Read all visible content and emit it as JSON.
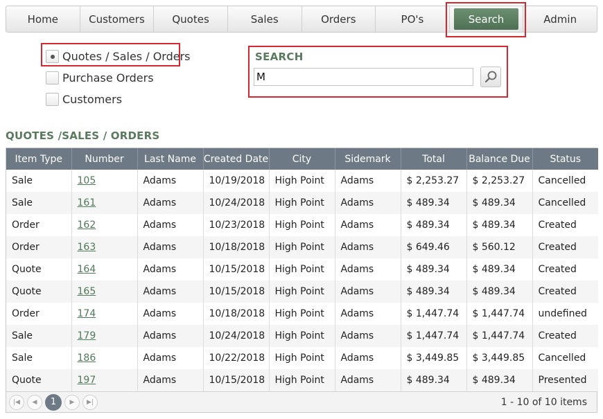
{
  "nav": {
    "items": [
      {
        "label": "Home"
      },
      {
        "label": "Customers"
      },
      {
        "label": "Quotes"
      },
      {
        "label": "Sales"
      },
      {
        "label": "Orders"
      },
      {
        "label": "PO's"
      },
      {
        "label": "Search",
        "active": true
      },
      {
        "label": "Admin"
      }
    ]
  },
  "filter": {
    "options": [
      {
        "label": "Quotes / Sales / Orders",
        "selected": true
      },
      {
        "label": "Purchase Orders",
        "selected": false
      },
      {
        "label": "Customers",
        "selected": false
      }
    ]
  },
  "search": {
    "title": "SEARCH",
    "value": "M",
    "button_icon": "magnifier-icon"
  },
  "results": {
    "title": "QUOTES /SALES / ORDERS",
    "columns": [
      "Item Type",
      "Number",
      "Last Name",
      "Created Date",
      "City",
      "Sidemark",
      "Total",
      "Balance Due",
      "Status"
    ],
    "rows": [
      [
        "Sale",
        "105",
        "Adams",
        "10/19/2018",
        "High Point",
        "Adams",
        "$ 2,253.27",
        "$ 2,253.27",
        "Cancelled"
      ],
      [
        "Sale",
        "161",
        "Adams",
        "10/24/2018",
        "High Point",
        "Adams",
        "$ 489.34",
        "$ 489.34",
        "Cancelled"
      ],
      [
        "Order",
        "162",
        "Adams",
        "10/23/2018",
        "High Point",
        "Adams",
        "$ 489.34",
        "$ 489.34",
        "Created"
      ],
      [
        "Order",
        "163",
        "Adams",
        "10/18/2018",
        "High Point",
        "Adams",
        "$ 649.46",
        "$ 560.12",
        "Created"
      ],
      [
        "Quote",
        "164",
        "Adams",
        "10/15/2018",
        "High Point",
        "Adams",
        "$ 489.34",
        "$ 489.34",
        "Created"
      ],
      [
        "Quote",
        "165",
        "Adams",
        "10/15/2018",
        "High Point",
        "Adams",
        "$ 489.34",
        "$ 489.34",
        "Created"
      ],
      [
        "Order",
        "174",
        "Adams",
        "10/18/2018",
        "High Point",
        "Adams",
        "$ 1,447.74",
        "$ 1,447.74",
        "undefined"
      ],
      [
        "Sale",
        "179",
        "Adams",
        "10/24/2018",
        "High Point",
        "Adams",
        "$ 1,447.74",
        "$ 1,447.74",
        "Created"
      ],
      [
        "Sale",
        "186",
        "Adams",
        "10/22/2018",
        "High Point",
        "Adams",
        "$ 3,449.85",
        "$ 3,449.85",
        "Cancelled"
      ],
      [
        "Quote",
        "197",
        "Adams",
        "10/15/2018",
        "High Point",
        "Adams",
        "$ 489.34",
        "$ 489.34",
        "Presented"
      ]
    ]
  },
  "pager": {
    "current_page": "1",
    "info": "1 - 10 of 10 items"
  },
  "colors": {
    "accent": "#5a7a5e",
    "active_tab": "#5d7f62",
    "header_bg": "#6d7a85",
    "highlight": "#d6262f",
    "link": "#4e7a58"
  }
}
